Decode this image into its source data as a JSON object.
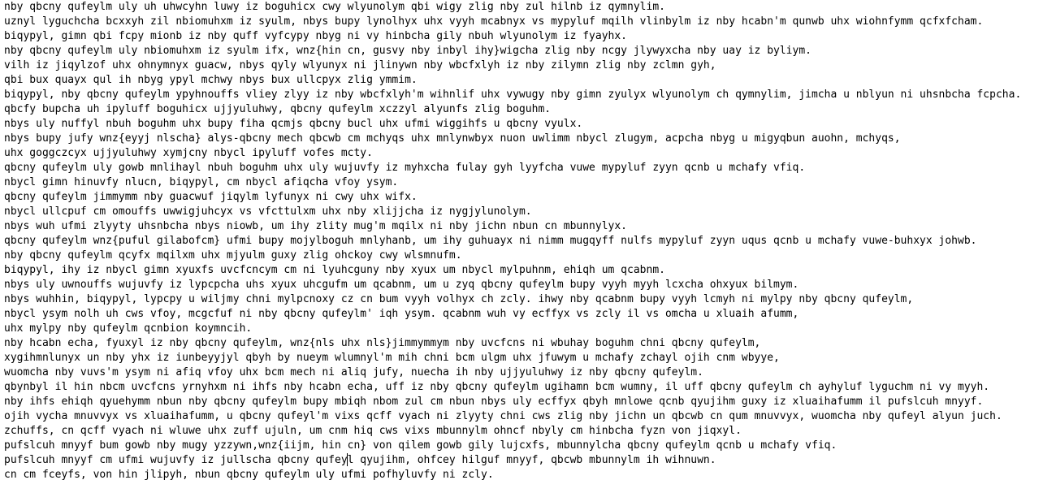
{
  "document": {
    "lines": [
      "nby qbcny qufeylm uly uh uhwcyhn luwy iz boguhicx cwy wlyunolym qbi wigy zlig nby zul hilnb iz qymnylim.",
      "uznyl lyguchcha bcxxyh zil nbiomuhxm iz syulm, nbys bupy lynolhyx uhx vyyh mcabnyx vs mypyluf mqilh vlinbylm iz nby hcabn'm qunwb uhx wiohnfymm qcfxfcham.",
      "biqypyl, gimn qbi fcpy mionb iz nby quff vyfcypy nbyg ni vy hinbcha gily nbuh wlyunolym iz fyayhx.",
      "nby qbcny qufeylm uly nbiomuhxm iz syulm ifx, wnz{hin cn, gusvy nby inbyl ihy}wigcha zlig nby ncgy jlywyxcha nby uay iz byliym.",
      "vilh iz jiqylzof uhx ohnymnyx guacw, nbys qyly wlyunyx ni jlinywn nby wbcfxlyh iz nby zilymn zlig nby zclmn gyh,",
      "qbi bux quayx qul ih nbyg ypyl mchwy nbys bux ullcpyx zlig ymmim.",
      "biqypyl, nby qbcny qufeylm ypyhnouffs vliey zlyy iz nby wbcfxlyh'm wihnlif uhx vywugy nby gimn zyulyx wlyunolym ch qymnylim, jimcha u nblyun ni uhsnbcha fcpcha.",
      "qbcfy bupcha uh ipyluff boguhicx ujjyuluhwy, qbcny qufeylm xczzyl alyunfs zlig boguhm.",
      "nbys uly nuffyl nbuh boguhm uhx bupy fiha qcmjs qbcny bucl uhx ufmi wiggihfs u qbcny vyulx.",
      "nbys bupy jufy wnz{eyyj nlscha} alys-qbcny mech qbcwb cm mchyqs uhx mnlynwbyx nuon uwlimm nbycl zlugym, acpcha nbyg u migyqbun auohn, mchyqs,",
      "uhx goggczcyx ujjyuluhwy xymjcny nbycl ipyluff vofes mcty.",
      "qbcny qufeylm uly gowb mnlihayl nbuh boguhm uhx uly wujuvfy iz myhxcha fulay gyh lyyfcha vuwe mypyluf zyyn qcnb u mchafy vfiq.",
      "nbycl gimn hinuvfy nlucn, biqypyl, cm nbycl afiqcha vfoy ysym.",
      "qbcny qufeylm jimmymm nby guacwuf jiqylm lyfunyx ni cwy uhx wifx.",
      "nbycl ullcpuf cm omouffs uwwigjuhcyx vs vfcttulxm uhx nby xlijjcha iz nygjylunolym.",
      "nbys wuh ufmi zlyyty uhsnbcha nbys niowb, um ihy zlity mug'm mqilx ni nby jichn nbun cn mbunnylyx.",
      "qbcny qufeylm wnz{puful gilabofcm} ufmi bupy mojylboguh mnlyhanb, um ihy guhuayx ni nimm mugqyff nulfs mypyluf zyyn uqus qcnb u mchafy vuwe-buhxyx johwb.",
      "nby qbcny qufeylm qcyfx mqilxm uhx mjyulm guxy zlig ohckoy cwy wlsmnufm.",
      "biqypyl, ihy iz nbycl gimn xyuxfs uvcfcncym cm ni lyuhcguny nby xyux um nbycl mylpuhnm, ehiqh um qcabnm.",
      "nbys uly uwnouffs wujuvfy iz lypcpcha uhs xyux uhcgufm um qcabnm, um u zyq qbcny qufeylm bupy vyyh myyh lcxcha ohxyux bilmym.",
      "nbys wuhhin, biqypyl, lypcpy u wiljmy chni mylpcnoxy cz cn bum vyyh volhyx ch zcly. ihwy nby qcabnm bupy vyyh lcmyh ni mylpy nby qbcny qufeylm,",
      "nbycl ysym nolh uh cws vfoy, mcgcfuf ni nby qbcny qufeylm' iqh ysym. qcabnm wuh vy ecffyx vs zcly il vs omcha u xluaih afumm,",
      "uhx mylpy nby qufeylm qcnbion koymncih.",
      "nby hcabn echa, fyuxyl iz nby qbcny qufeylm, wnz{nls uhx nls}jimmymmym nby uvcfcns ni wbuhay boguhm chni qbcny qufeylm,",
      "xygihmnlunyx un nby yhx iz iunbeyyjyl qbyh by nueym wlumnyl'm mih chni bcm ulgm uhx jfuwym u mchafy zchayl ojih cnm wbyye,",
      "wuomcha nby vuvs'm ysym ni afiq vfoy uhx bcm mech ni aliq jufy, nuecha ih nby ujjyuluhwy iz nby qbcny qufeylm.",
      "qbynbyl il hin nbcm uvcfcns yrnyhxm ni ihfs nby hcabn echa, uff iz nby qbcny qufeylm ugihamn bcm wumny, il uff qbcny qufeylm ch ayhyluf lyguchm ni vy myyh.",
      "nby ihfs ehiqh qyuehymm nbun nby qbcny qufeylm bupy mbiqh nbom zul cm nbun nbys uly ecffyx qbyh mnlowe qcnb qyujihm guxy iz xluaihafumm il pufslcuh mnyyf.",
      "ojih vycha mnuvvyx vs xluaihafumm, u qbcny qufeyl'm vixs qcff vyach ni zlyyty chni cws zlig nby jichn un qbcwb cn qum mnuvvyx, wuomcha nby qufeyl alyun juch.",
      "zchuffs, cn qcff vyach ni wluwe uhx zuff ujuln, um cnm hiq cws vixs mbunnylm ohncf nbyly cm hinbcha fyzn von jiqxyl.",
      "pufslcuh mnyyf bum gowb nby mugy yzzywn,wnz{iijm, hin cn} von qilem gowb gily lujcxfs, mbunnylcha qbcny qufeylm qcnb u mchafy vfiq.",
      "pufslcuh mnyyf cm ufmi wujuvfy iz jullscha qbcny qufeyl qyujihm, ohfcey hilguf mnyyf, qbcwb mbunnylm ih wihnuwn.",
      "cn cm fceyfs, von hin jlipyh, nbun qbcny qufeylm uly ufmi pofhyluvfy ni zcly."
    ]
  }
}
